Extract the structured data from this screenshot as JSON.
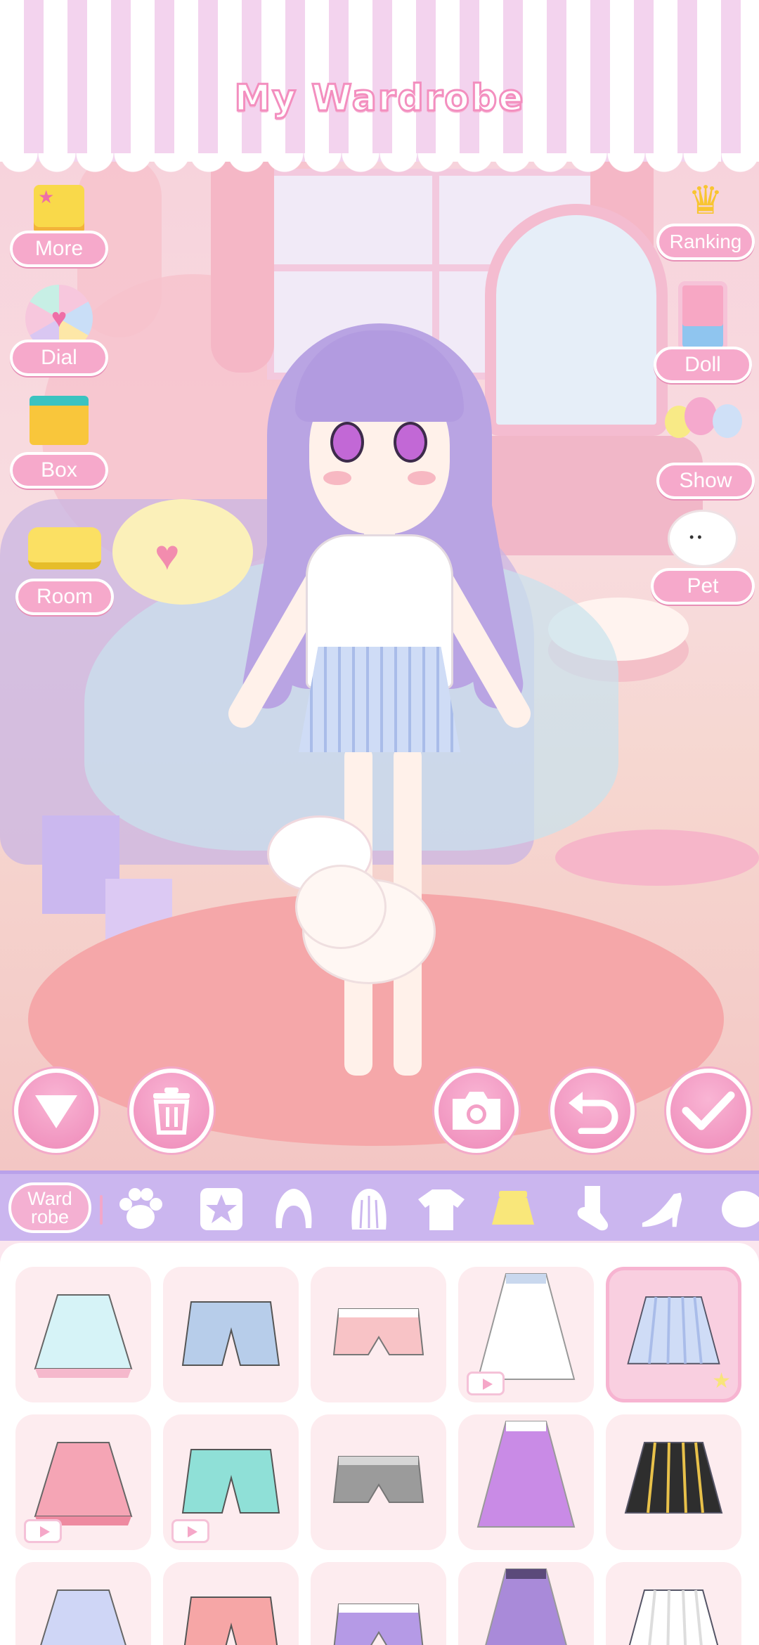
{
  "header": {
    "title": "My Wardrobe"
  },
  "left_menu": [
    {
      "label": "More",
      "icon": "menu-list-icon"
    },
    {
      "label": "Dial",
      "icon": "prize-wheel-icon"
    },
    {
      "label": "Box",
      "icon": "gift-box-icon"
    },
    {
      "label": "Room",
      "icon": "room-furniture-icon"
    }
  ],
  "right_menu": [
    {
      "label": "Ranking",
      "icon": "crown-icon"
    },
    {
      "label": "Doll",
      "icon": "claw-machine-icon"
    },
    {
      "label": "Show",
      "icon": "balloons-icon"
    },
    {
      "label": "Pet",
      "icon": "puppy-icon"
    }
  ],
  "actions": [
    {
      "name": "collapse",
      "icon": "triangle-down-icon"
    },
    {
      "name": "delete",
      "icon": "trash-icon"
    },
    {
      "name": "camera",
      "icon": "camera-icon"
    },
    {
      "name": "undo",
      "icon": "undo-icon"
    },
    {
      "name": "confirm",
      "icon": "checkmark-icon"
    }
  ],
  "category_bar": {
    "wardrobe_tab": {
      "line1": "Ward",
      "line2": "robe"
    },
    "categories": [
      {
        "name": "paw",
        "icon": "paw-icon",
        "active": false
      },
      {
        "name": "favorites",
        "icon": "star-icon",
        "active": false
      },
      {
        "name": "hair-front",
        "icon": "hair-front-icon",
        "active": false
      },
      {
        "name": "hair-back",
        "icon": "hair-back-icon",
        "active": false
      },
      {
        "name": "tops",
        "icon": "tshirt-icon",
        "active": false
      },
      {
        "name": "skirts",
        "icon": "skirt-icon",
        "active": true
      },
      {
        "name": "socks",
        "icon": "sock-icon",
        "active": false
      },
      {
        "name": "shoes",
        "icon": "heel-shoe-icon",
        "active": false
      },
      {
        "name": "more",
        "icon": "bubble-icon",
        "active": false
      }
    ]
  },
  "items": [
    {
      "name": "lace-skirt-mint",
      "colors": [
        "#d6f3f7",
        "#f5b8cc"
      ],
      "ad": false,
      "selected": false
    },
    {
      "name": "denim-shorts",
      "colors": [
        "#b7cdea",
        "#8da9cf"
      ],
      "ad": false,
      "selected": false
    },
    {
      "name": "pink-shorts",
      "colors": [
        "#f8c3c6",
        "#ffffff"
      ],
      "ad": false,
      "selected": false
    },
    {
      "name": "white-sheer-skirt",
      "colors": [
        "#ffffff",
        "#c9d8ee"
      ],
      "ad": true,
      "selected": false
    },
    {
      "name": "plaid-blue-skirt",
      "colors": [
        "#cfdcf6",
        "#a9bce9"
      ],
      "ad": false,
      "selected": true
    },
    {
      "name": "pink-pleated-skirt",
      "colors": [
        "#f5a5b5",
        "#ee8aa0"
      ],
      "ad": true,
      "selected": false
    },
    {
      "name": "mint-open-skirt",
      "colors": [
        "#8fe0d7",
        "#ffffff"
      ],
      "ad": true,
      "selected": false
    },
    {
      "name": "grey-shorts",
      "colors": [
        "#9b9b9b",
        "#d6d6d6"
      ],
      "ad": false,
      "selected": false
    },
    {
      "name": "purple-dot-skirt",
      "colors": [
        "#c98be6",
        "#ffffff"
      ],
      "ad": false,
      "selected": false
    },
    {
      "name": "black-mermaid-skirt",
      "colors": [
        "#2e2e2e",
        "#e8c14a"
      ],
      "ad": false,
      "selected": false
    },
    {
      "name": "blue-bow-skirt",
      "colors": [
        "#cfd6f6",
        "#7f8fe8"
      ],
      "ad": false,
      "selected": false
    },
    {
      "name": "coral-layer-skirt",
      "colors": [
        "#f6a6a6",
        "#fbd4d4"
      ],
      "ad": false,
      "selected": false
    },
    {
      "name": "galaxy-skirt",
      "colors": [
        "#b59ae6",
        "#ffffff"
      ],
      "ad": false,
      "selected": false
    },
    {
      "name": "cat-purple-skirt",
      "colors": [
        "#a98ad9",
        "#5b4a7a"
      ],
      "ad": false,
      "selected": false
    },
    {
      "name": "white-long-skirt",
      "colors": [
        "#ffffff",
        "#dddddd"
      ],
      "ad": false,
      "selected": false
    }
  ]
}
